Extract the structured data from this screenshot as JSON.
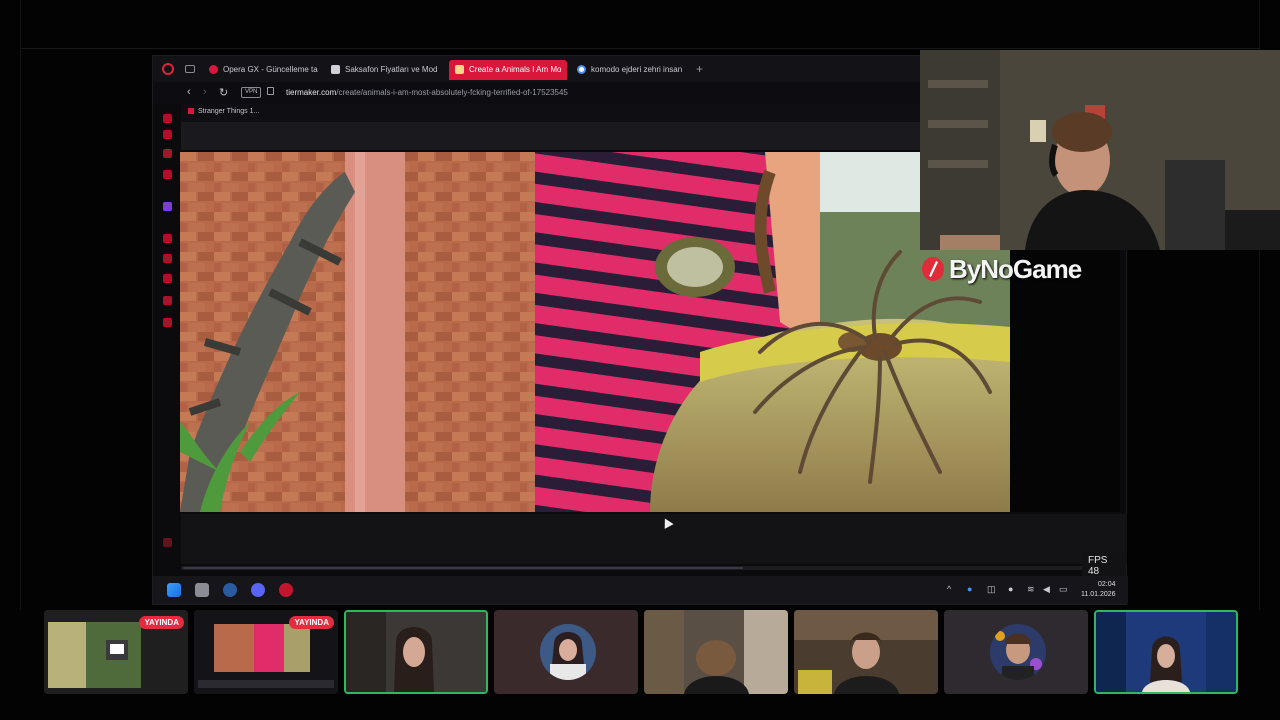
{
  "browser": {
    "tabs": [
      {
        "label": "Opera GX - Güncelleme ta",
        "fav_color": "#d8173a",
        "active": false
      },
      {
        "label": "Saksafon Fiyatları ve Mod",
        "fav_color": "#d0d0d8",
        "active": false
      },
      {
        "label": "Create a Animals I Am Mo",
        "fav_color": "#f7d78a",
        "active": true
      },
      {
        "label": "komodo ejderi zehri insan",
        "fav_color": "#4d8ff0",
        "active": false
      }
    ],
    "new_tab": "+",
    "vpn_label": "VPN",
    "url_host": "tiermaker.com",
    "url_path": "/create/animals-i-am-most-absolutely-fcking-terrified-of-17523545",
    "bookmark": "Stranger Things 1...",
    "fps": "FPS 48",
    "accent": "#d8173a"
  },
  "taskbar": {
    "time": "02:04",
    "date": "11.01.2026",
    "icons": [
      "windows-start-icon",
      "file-explorer-icon",
      "steam-icon",
      "discord-icon",
      "opera-gx-icon"
    ]
  },
  "overlay": {
    "brand": "ByNoGame"
  },
  "participants": [
    {
      "kind": "stream",
      "badge": "YAYINDA"
    },
    {
      "kind": "stream",
      "badge": "YAYINDA"
    },
    {
      "kind": "camera",
      "speaking": true
    },
    {
      "kind": "avatar",
      "speaking": false
    },
    {
      "kind": "camera",
      "speaking": false
    },
    {
      "kind": "camera",
      "speaking": false
    },
    {
      "kind": "avatar",
      "speaking": false
    },
    {
      "kind": "camera",
      "speaking": true
    }
  ],
  "colors": {
    "live": "#e62b3e",
    "speaking": "#2fb85f",
    "opera_red": "#d8173a"
  }
}
